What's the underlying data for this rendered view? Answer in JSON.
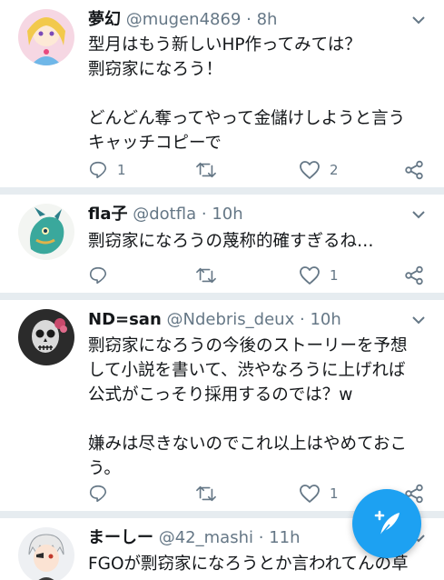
{
  "tweets": [
    {
      "name": "夢幻",
      "handle": "@mugen4869",
      "sep": "·",
      "time": "8h",
      "text": "型月はもう新しいHP作ってみては？\n剽窃家になろう！\n\nどんどん奪ってやって金儲けしようと言う\nキャッチコピーで",
      "reply_count": "1",
      "retweet_count": "",
      "like_count": "2"
    },
    {
      "name": "fla子",
      "handle": "@dotfla",
      "sep": "·",
      "time": "10h",
      "text": "剽窃家になろうの蔑称的確すぎるね…",
      "reply_count": "",
      "retweet_count": "",
      "like_count": "1"
    },
    {
      "name": "ND=san",
      "handle": "@Ndebris_deux",
      "sep": "·",
      "time": "10h",
      "text": "剽窃家になろうの今後のストーリーを予想\nして小説を書いて、渋やなろうに上げれば\n公式がこっそり採用するのでは？w\n\n嫌みは尽きないのでこれ以上はやめておこ\nう。",
      "reply_count": "",
      "retweet_count": "",
      "like_count": "1"
    },
    {
      "name": "まーしー",
      "handle": "@42_mashi",
      "sep": "·",
      "time": "11h",
      "text": "FGOが剽窃家になろうとか言われてんの草",
      "reply_count": "",
      "retweet_count": "",
      "like_count": ""
    }
  ],
  "colors": {
    "accent": "#1da1f2",
    "secondary_text": "#657786",
    "divider": "#e6ecf0"
  },
  "icons": [
    "reply-icon",
    "retweet-icon",
    "like-icon",
    "share-icon",
    "chevron-down-icon",
    "compose-tweet-icon"
  ]
}
